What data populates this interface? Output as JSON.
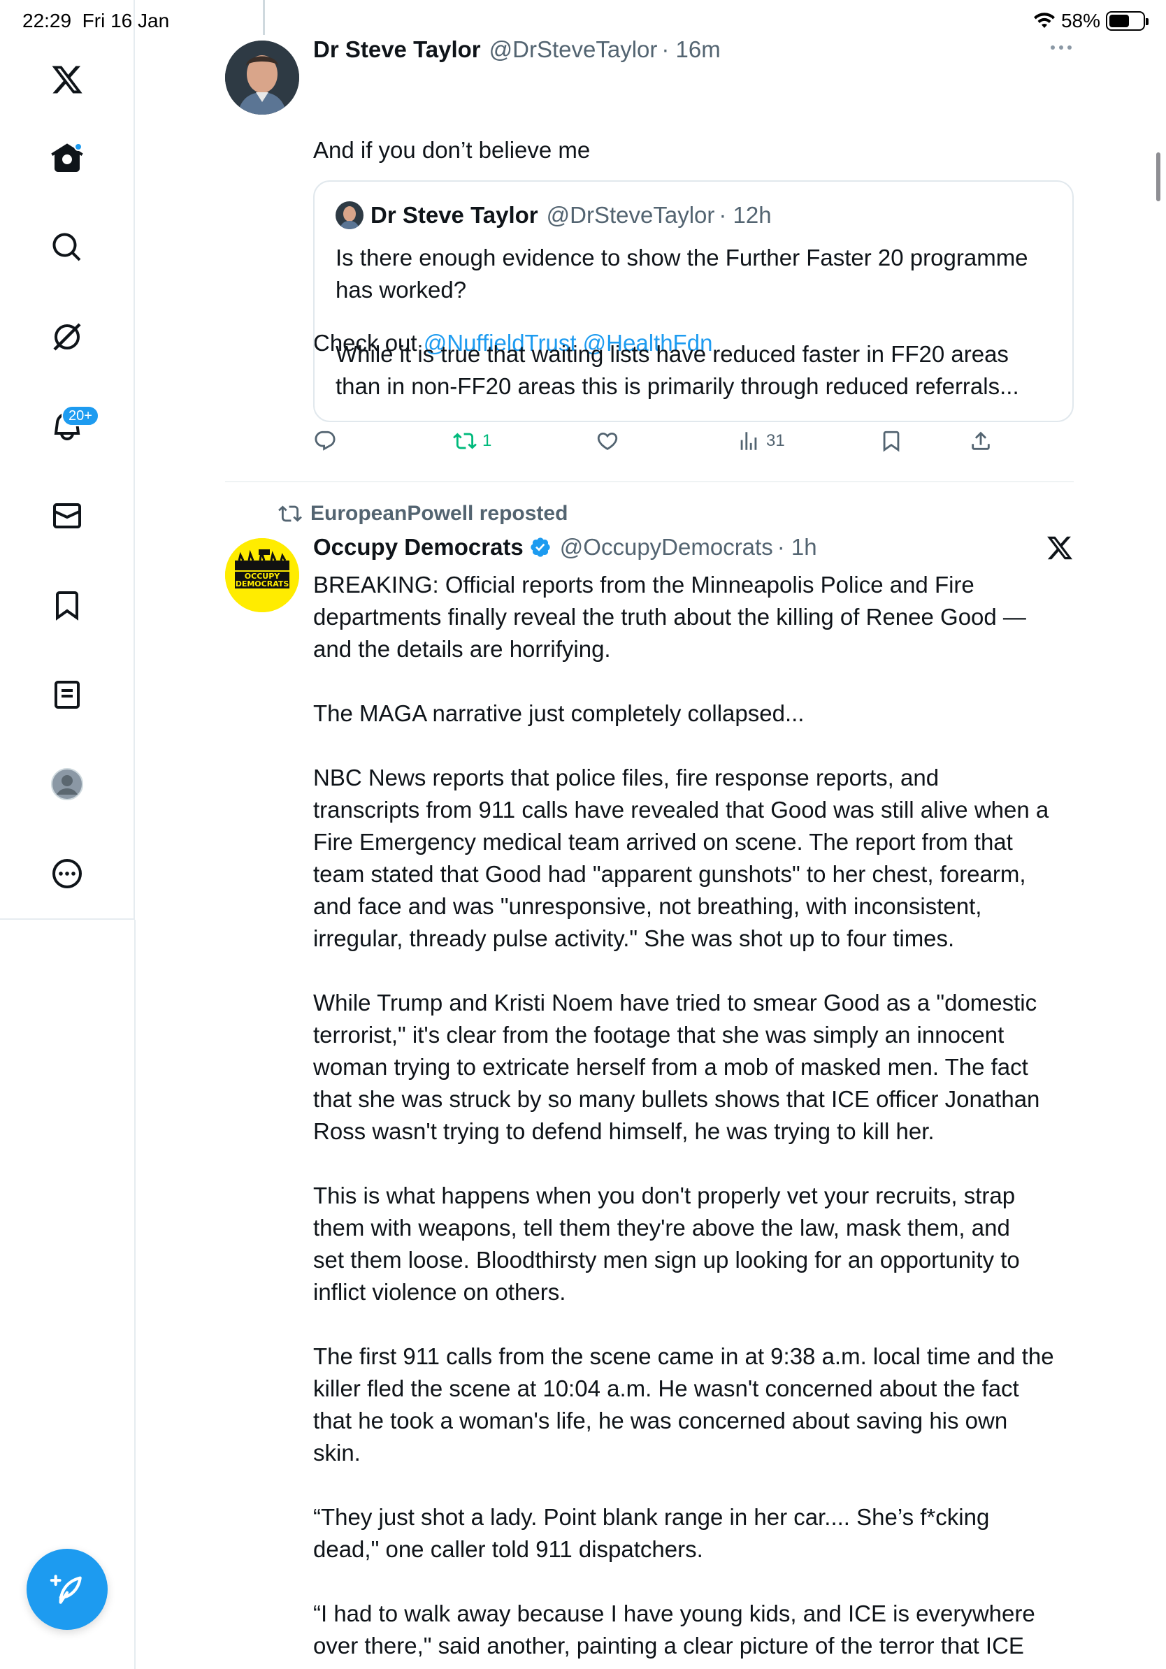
{
  "status_bar": {
    "time": "22:29",
    "date": "Fri 16 Jan",
    "battery": "58%"
  },
  "sidebar": {
    "items": [
      {
        "name": "x-logo",
        "icon": "x-logo-icon"
      },
      {
        "name": "home",
        "icon": "home-icon",
        "badge_dot": true
      },
      {
        "name": "explore",
        "icon": "search-icon"
      },
      {
        "name": "grok",
        "icon": "grok-icon"
      },
      {
        "name": "notifications",
        "icon": "bell-icon",
        "badge": "20+"
      },
      {
        "name": "messages",
        "icon": "mail-icon"
      },
      {
        "name": "bookmarks",
        "icon": "bookmark-icon"
      },
      {
        "name": "lists",
        "icon": "list-icon"
      },
      {
        "name": "profile",
        "icon": "profile-icon"
      },
      {
        "name": "more",
        "icon": "more-circle-icon"
      }
    ],
    "compose": {
      "icon": "compose-feather-icon"
    }
  },
  "tweet1": {
    "name": "Dr Steve Taylor",
    "handle": "@DrSteveTaylor",
    "time": "· 16m",
    "text_line1": "And if you don’t believe me",
    "text_line2_prefix": "Check out ",
    "mention1": "@NuffieldTrust",
    "mention2": "@HealthFdn",
    "quote": {
      "name": "Dr Steve Taylor",
      "handle": "@DrSteveTaylor",
      "time": "· 12h",
      "text": "Is there enough evidence to show the Further Faster 20 programme\nhas worked?\n\nWhile it is true that waiting lists have reduced faster in FF20 areas\nthan in non-FF20 areas this is primarily through reduced referrals..."
    },
    "actions": {
      "reply_count": "",
      "retweet_count": "1",
      "like_count": "",
      "views_count": "31"
    }
  },
  "tweet2": {
    "repost_label": "EuropeanPowell reposted",
    "name": "Occupy Democrats",
    "handle": "@OccupyDemocrats",
    "time": "· 1h",
    "avatar_text": "OCCUPY\nDEMOCRATS",
    "text": "BREAKING: Official reports from the Minneapolis Police and Fire\ndepartments finally reveal the truth about the killing of Renee Good —\nand the details are horrifying.\n\nThe MAGA narrative just completely collapsed...\n\nNBC News reports that police files, fire response reports, and\ntranscripts from 911 calls have revealed that Good was still alive when a\nFire Emergency medical team arrived on scene. The report from that\nteam stated that Good had \"apparent gunshots\" to her chest, forearm,\nand face and was \"unresponsive, not breathing, with inconsistent,\nirregular, thready pulse activity.\" She was shot up to four times.\n\nWhile Trump and Kristi Noem have tried to smear Good as a \"domestic\nterrorist,\" it's clear from the footage that she was simply an innocent\nwoman trying to extricate herself from a mob of masked men. The fact\nthat she was struck by so many bullets shows that ICE officer Jonathan\nRoss wasn't trying to defend himself, he was trying to kill her.\n\nThis is what happens when you don't properly vet your recruits, strap\nthem with weapons, tell them they're above the law, mask them, and\nset them loose. Bloodthirsty men sign up looking for an opportunity to\ninflict violence on others.\n\nThe first 911 calls from the scene came in at 9:38 a.m. local time and the\nkiller fled the scene at 10:04 a.m. He wasn't concerned about the fact\nthat he took a woman's life, he was concerned about saving his own\nskin.\n\n“They just shot a lady. Point blank range in her car.... She’s f*cking\ndead,\" one caller told 911 dispatchers.\n\n“I had to walk away because I have young kids, and ICE is everywhere\nover there,\" said another, painting a clear picture of the terror that ICE"
  },
  "colors": {
    "accent": "#1d9bf0",
    "retweet_green": "#00ba7c",
    "secondary_text": "#536471",
    "occupy_yellow": "#ffec00"
  }
}
